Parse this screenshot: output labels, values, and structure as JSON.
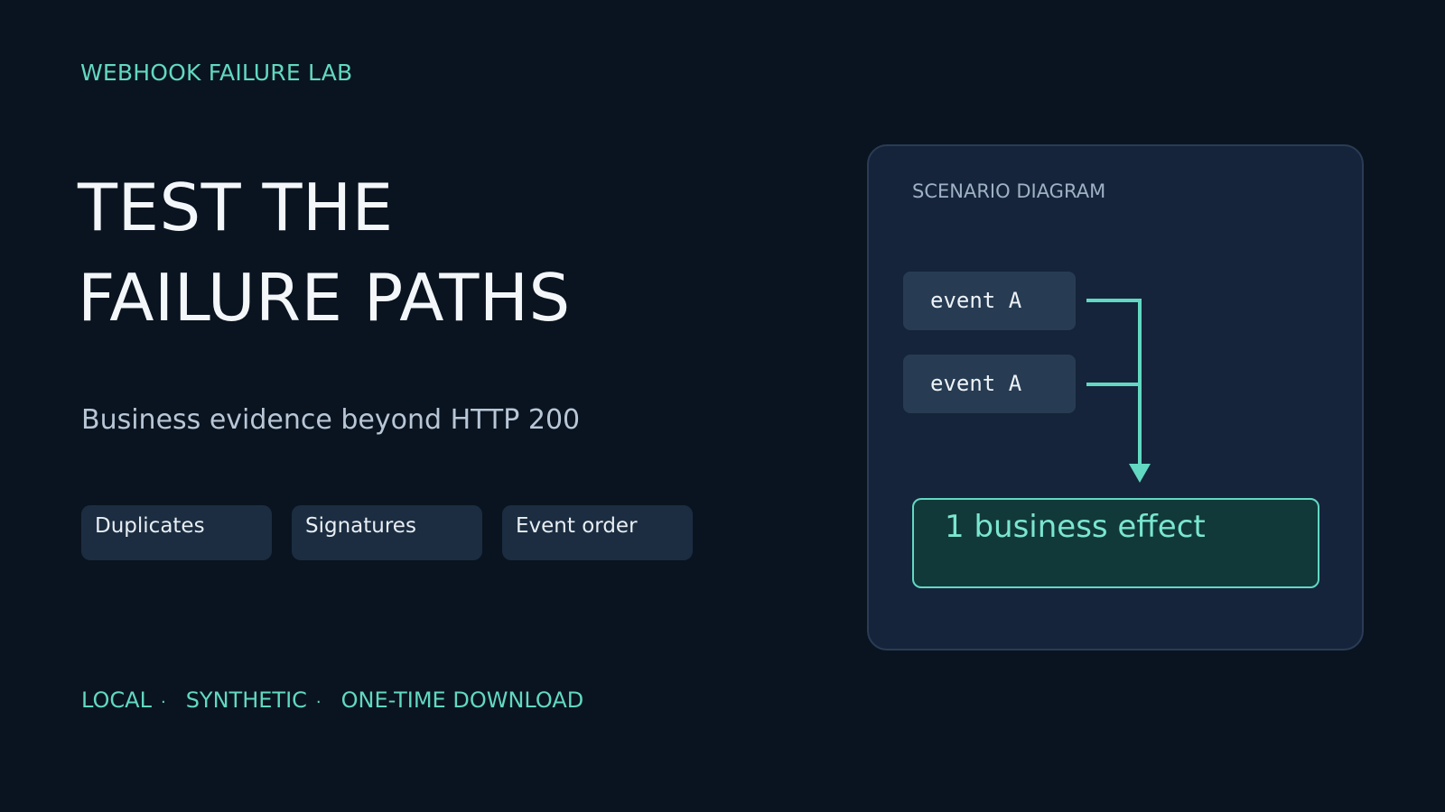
{
  "brand": {
    "eyebrow": "WEBHOOK FAILURE LAB"
  },
  "hero": {
    "headline_lines": [
      "TEST THE",
      "FAILURE PATHS"
    ],
    "subtitle": "Business evidence beyond HTTP 200"
  },
  "tags": [
    {
      "label": "Duplicates"
    },
    {
      "label": "Signatures"
    },
    {
      "label": "Event order"
    }
  ],
  "footer": {
    "items": [
      "LOCAL",
      "SYNTHETIC",
      "ONE-TIME DOWNLOAD"
    ],
    "separator": "·"
  },
  "diagram": {
    "label": "SCENARIO DIAGRAM",
    "events": [
      {
        "label": "event A"
      },
      {
        "label": "event A"
      }
    ],
    "result": "1 business effect"
  },
  "colors": {
    "background": "#0a1420",
    "accent": "#62d8c2",
    "panel": "#15243a",
    "chip": "#1c2d41",
    "result_fill": "#12393a"
  }
}
